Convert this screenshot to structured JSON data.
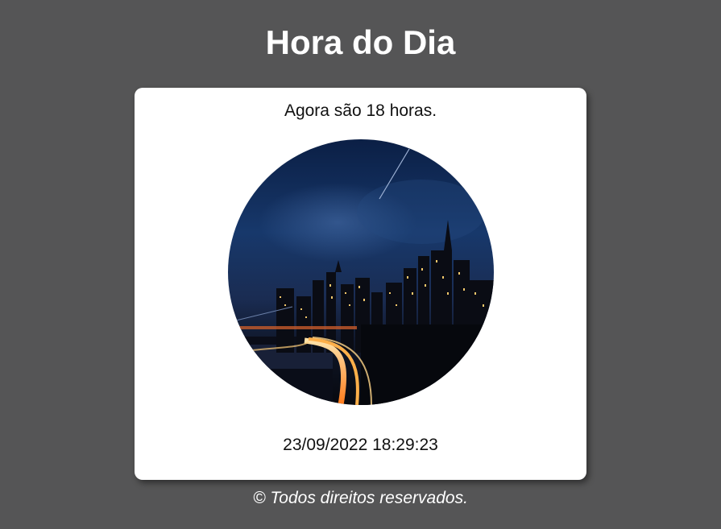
{
  "header": {
    "title": "Hora do Dia"
  },
  "card": {
    "message": "Agora são 18 horas.",
    "image": {
      "description_icon": "night-city-photo"
    },
    "datetime": "23/09/2022 18:29:23"
  },
  "footer": {
    "text": "© Todos direitos reservados."
  },
  "colors": {
    "background": "#555556",
    "card": "#ffffff",
    "title": "#ffffff"
  }
}
